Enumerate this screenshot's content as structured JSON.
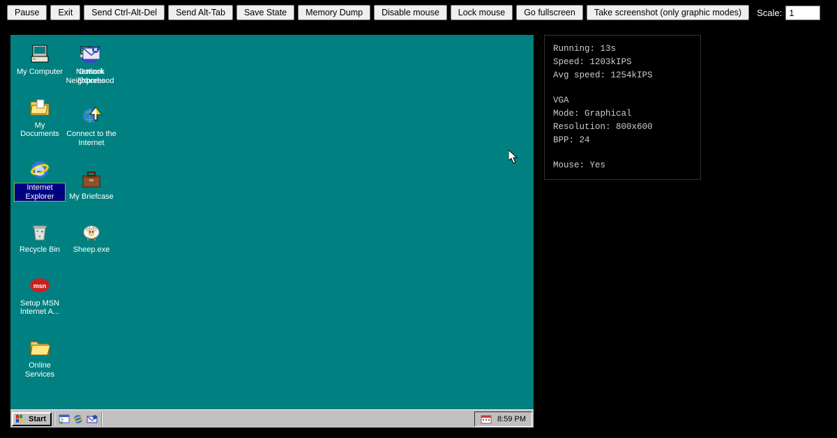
{
  "toolbar": {
    "pause": "Pause",
    "exit": "Exit",
    "send_cad": "Send Ctrl-Alt-Del",
    "send_at": "Send Alt-Tab",
    "save_state": "Save State",
    "mem_dump": "Memory Dump",
    "disable_mouse": "Disable mouse",
    "lock_mouse": "Lock mouse",
    "fullscreen": "Go fullscreen",
    "screenshot": "Take screenshot (only graphic modes)",
    "scale_label": "Scale:",
    "scale_value": "1"
  },
  "desktop_icons": {
    "my_computer": "My Computer",
    "my_documents": "My Documents",
    "ie": "Internet Explorer",
    "recycle_bin": "Recycle Bin",
    "setup_msn": "Setup MSN Internet A...",
    "online_services": "Online Services",
    "network": "Network Neighborhood",
    "outlook": "Outlook Express",
    "connect": "Connect to the Internet",
    "briefcase": "My Briefcase",
    "sheep": "Sheep.exe"
  },
  "taskbar": {
    "start": "Start",
    "time": "8:59 PM"
  },
  "stats": {
    "running": "Running: 13s",
    "speed": "Speed: 1203kIPS",
    "avg": "Avg speed: 1254kIPS",
    "vga": "VGA",
    "mode": "Mode: Graphical",
    "resolution": "Resolution: 800x600",
    "bpp": "BPP: 24",
    "mouse": "Mouse: Yes"
  }
}
